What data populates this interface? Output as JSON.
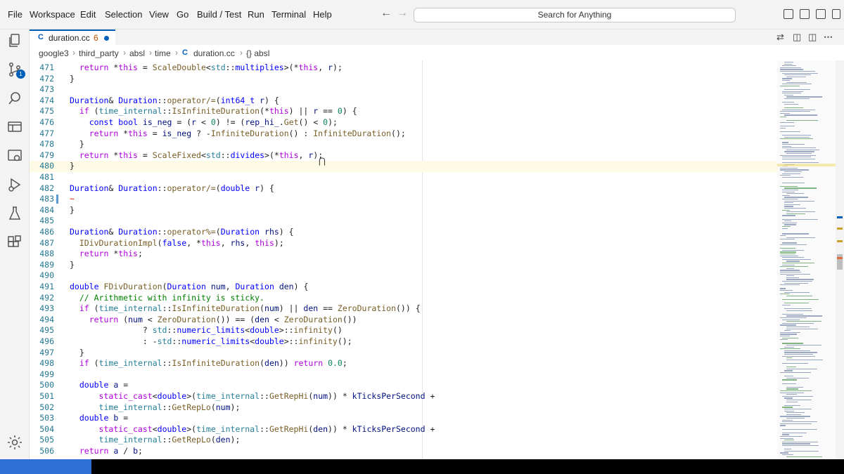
{
  "menubar": {
    "items": [
      "File",
      "Workspace",
      "Edit",
      "Selection",
      "View",
      "Go",
      "Build / Test",
      "Run",
      "Terminal",
      "Help"
    ],
    "search_placeholder": "Search for Anything"
  },
  "activity_bar": {
    "icons": [
      "explorer-icon",
      "source-control-icon",
      "search-icon",
      "remote-explorer-icon",
      "run-debug-icon",
      "testing-icon",
      "extensions-icon",
      "settings-gear-icon"
    ],
    "source_control_badge": "1"
  },
  "tab": {
    "icon": "C",
    "label": "duration.cc",
    "problems": "6"
  },
  "breadcrumb": [
    "google3",
    "third_party",
    "absl",
    "time",
    "duration.cc",
    "{} absl"
  ],
  "editor": {
    "lines": [
      {
        "n": "471",
        "html": "  <span class=\"kw\">return</span> *<span class=\"kw\">this</span> = <span class=\"fn\">ScaleDouble</span>&lt;<span class=\"ns\">std</span>::<span class=\"ty\">multiplies</span>&gt;(*<span class=\"kw\">this</span>, <span class=\"vr\">r</span>);"
      },
      {
        "n": "472",
        "html": "}"
      },
      {
        "n": "473",
        "html": ""
      },
      {
        "n": "474",
        "html": "<span class=\"ty\">Duration</span>&amp; <span class=\"ty\">Duration</span>::<span class=\"fn\">operator/=</span>(<span class=\"ty\">int64_t</span> <span class=\"vr\">r</span>) {"
      },
      {
        "n": "475",
        "html": "  <span class=\"kw\">if</span> (<span class=\"ns\">time_internal</span>::<span class=\"fn\">IsInfiniteDuration</span>(*<span class=\"kw\">this</span>) || <span class=\"vr\">r</span> == <span class=\"nm\">0</span>) {"
      },
      {
        "n": "476",
        "html": "    <span class=\"ty\">const</span> <span class=\"ty\">bool</span> <span class=\"vr\">is_neg</span> = (<span class=\"vr\">r</span> &lt; <span class=\"nm\">0</span>) != (<span class=\"vr\">rep_hi_</span>.<span class=\"fn\">Get</span>() &lt; <span class=\"nm\">0</span>);"
      },
      {
        "n": "477",
        "html": "    <span class=\"kw\">return</span> *<span class=\"kw\">this</span> = <span class=\"vr\">is_neg</span> ? -<span class=\"fn\">InfiniteDuration</span>() : <span class=\"fn\">InfiniteDuration</span>();"
      },
      {
        "n": "478",
        "html": "  }"
      },
      {
        "n": "479",
        "html": "  <span class=\"kw\">return</span> *<span class=\"kw\">this</span> = <span class=\"fn\">ScaleFixed</span>&lt;<span class=\"ns\">std</span>::<span class=\"ty\">divides</span>&gt;(*<span class=\"kw\">this</span>, <span class=\"vr\">r</span>);"
      },
      {
        "n": "480",
        "html": "}"
      },
      {
        "n": "481",
        "html": ""
      },
      {
        "n": "482",
        "html": "<span class=\"ty\">Duration</span>&amp; <span class=\"ty\">Duration</span>::<span class=\"fn\">operator/=</span>(<span class=\"ty\">double</span> <span class=\"vr\">r</span>) {"
      },
      {
        "n": "483",
        "html": "<span style=\"color:#e51400\">~</span>"
      },
      {
        "n": "484",
        "html": "}"
      },
      {
        "n": "485",
        "html": ""
      },
      {
        "n": "486",
        "html": "<span class=\"ty\">Duration</span>&amp; <span class=\"ty\">Duration</span>::<span class=\"fn\">operator%=</span>(<span class=\"ty\">Duration</span> <span class=\"vr\">rhs</span>) {"
      },
      {
        "n": "487",
        "html": "  <span class=\"fn\">IDivDurationImpl</span>(<span class=\"ty\">false</span>, *<span class=\"kw\">this</span>, <span class=\"vr\">rhs</span>, <span class=\"kw\">this</span>);"
      },
      {
        "n": "488",
        "html": "  <span class=\"kw\">return</span> *<span class=\"kw\">this</span>;"
      },
      {
        "n": "489",
        "html": "}"
      },
      {
        "n": "490",
        "html": ""
      },
      {
        "n": "491",
        "html": "<span class=\"ty\">double</span> <span class=\"fn\">FDivDuration</span>(<span class=\"ty\">Duration</span> <span class=\"vr\">num</span>, <span class=\"ty\">Duration</span> <span class=\"vr\">den</span>) {"
      },
      {
        "n": "492",
        "html": "  <span class=\"cm\">// Arithmetic with infinity is sticky.</span>"
      },
      {
        "n": "493",
        "html": "  <span class=\"kw\">if</span> (<span class=\"ns\">time_internal</span>::<span class=\"fn\">IsInfiniteDuration</span>(<span class=\"vr\">num</span>) || <span class=\"vr\">den</span> == <span class=\"fn\">ZeroDuration</span>()) {"
      },
      {
        "n": "494",
        "html": "    <span class=\"kw\">return</span> (<span class=\"vr\">num</span> &lt; <span class=\"fn\">ZeroDuration</span>()) == (<span class=\"vr\">den</span> &lt; <span class=\"fn\">ZeroDuration</span>())"
      },
      {
        "n": "495",
        "html": "               ? <span class=\"ns\">std</span>::<span class=\"ty\">numeric_limits</span>&lt;<span class=\"ty\">double</span>&gt;::<span class=\"fn\">infinity</span>()"
      },
      {
        "n": "496",
        "html": "               : -<span class=\"ns\">std</span>::<span class=\"ty\">numeric_limits</span>&lt;<span class=\"ty\">double</span>&gt;::<span class=\"fn\">infinity</span>();"
      },
      {
        "n": "497",
        "html": "  }"
      },
      {
        "n": "498",
        "html": "  <span class=\"kw\">if</span> (<span class=\"ns\">time_internal</span>::<span class=\"fn\">IsInfiniteDuration</span>(<span class=\"vr\">den</span>)) <span class=\"kw\">return</span> <span class=\"nm\">0.0</span>;"
      },
      {
        "n": "499",
        "html": ""
      },
      {
        "n": "500",
        "html": "  <span class=\"ty\">double</span> <span class=\"vr\">a</span> ="
      },
      {
        "n": "501",
        "html": "      <span class=\"kw\">static_cast</span>&lt;<span class=\"ty\">double</span>&gt;(<span class=\"ns\">time_internal</span>::<span class=\"fn\">GetRepHi</span>(<span class=\"vr\">num</span>)) * <span class=\"vr\">kTicksPerSecond</span> +"
      },
      {
        "n": "502",
        "html": "      <span class=\"ns\">time_internal</span>::<span class=\"fn\">GetRepLo</span>(<span class=\"vr\">num</span>);"
      },
      {
        "n": "503",
        "html": "  <span class=\"ty\">double</span> <span class=\"vr\">b</span> ="
      },
      {
        "n": "504",
        "html": "      <span class=\"kw\">static_cast</span>&lt;<span class=\"ty\">double</span>&gt;(<span class=\"ns\">time_internal</span>::<span class=\"fn\">GetRepHi</span>(<span class=\"vr\">den</span>)) * <span class=\"vr\">kTicksPerSecond</span> +"
      },
      {
        "n": "505",
        "html": "      <span class=\"ns\">time_internal</span>::<span class=\"fn\">GetRepLo</span>(<span class=\"vr\">den</span>);"
      },
      {
        "n": "506",
        "html": "  <span class=\"kw\">return</span> <span class=\"vr\">a</span> / <span class=\"vr\">b</span>;"
      }
    ],
    "highlight_line": "480",
    "diff_lines": [
      "483"
    ]
  },
  "colors": {
    "accent": "#005fb8",
    "status_left": "#2e6fd6"
  }
}
